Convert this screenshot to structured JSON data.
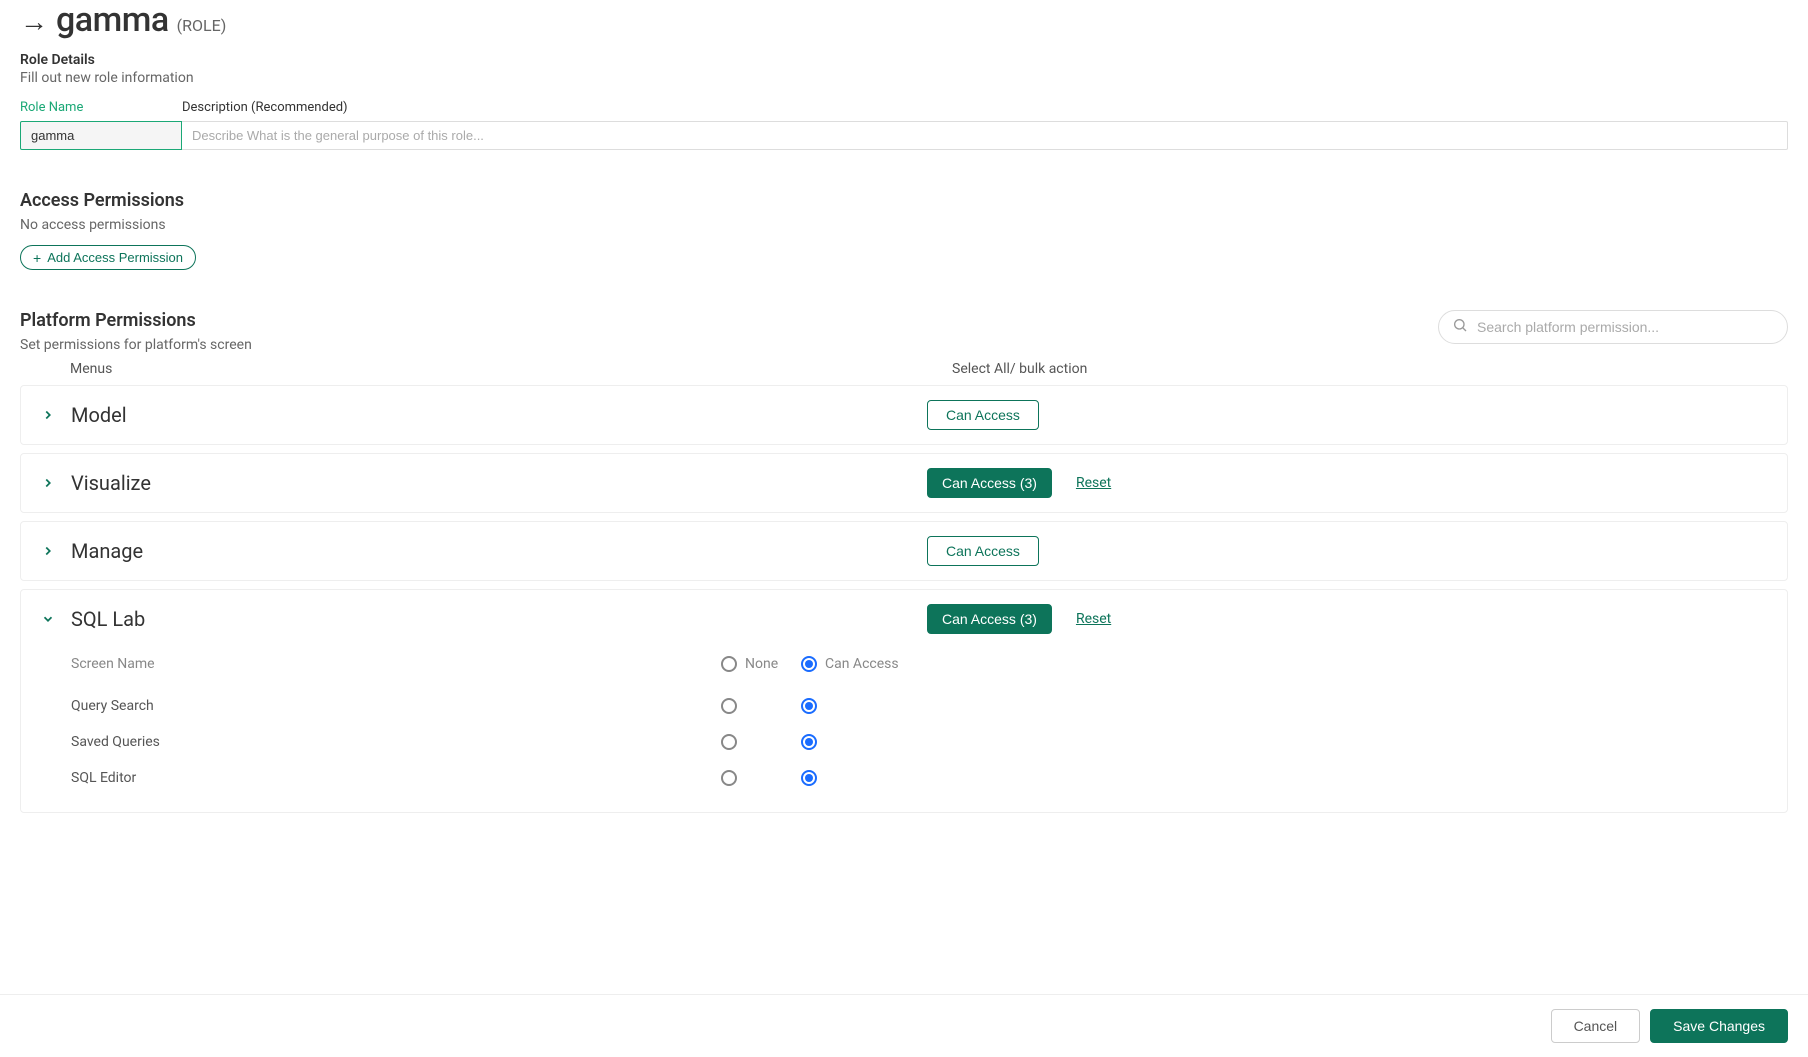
{
  "header": {
    "title": "gamma",
    "role_tag": "(ROLE)"
  },
  "role_details": {
    "heading": "Role Details",
    "subheading": "Fill out new role information",
    "name_label": "Role Name",
    "name_value": "gamma",
    "desc_label": "Description (Recommended)",
    "desc_placeholder": "Describe What is the general purpose of this role..."
  },
  "access": {
    "heading": "Access Permissions",
    "empty_text": "No access permissions",
    "add_label": "Add Access Permission"
  },
  "platform": {
    "heading": "Platform Permissions",
    "subheading": "Set permissions for platform's screen",
    "search_placeholder": "Search platform permission...",
    "col_menus": "Menus",
    "col_select_all": "Select All/ bulk action",
    "reset_label": "Reset",
    "rows": [
      {
        "name": "Model",
        "access_label": "Can Access",
        "solid": false,
        "expanded": false
      },
      {
        "name": "Visualize",
        "access_label": "Can Access (3)",
        "solid": true,
        "expanded": false
      },
      {
        "name": "Manage",
        "access_label": "Can Access",
        "solid": false,
        "expanded": false
      },
      {
        "name": "SQL Lab",
        "access_label": "Can Access (3)",
        "solid": true,
        "expanded": true
      }
    ],
    "expanded_header": {
      "screen_name": "Screen Name",
      "none": "None",
      "can_access": "Can Access"
    },
    "sql_lab_items": [
      {
        "name": "Query Search",
        "selected": "access"
      },
      {
        "name": "Saved Queries",
        "selected": "access"
      },
      {
        "name": "SQL Editor",
        "selected": "access"
      }
    ]
  },
  "footer": {
    "cancel": "Cancel",
    "save": "Save Changes"
  }
}
